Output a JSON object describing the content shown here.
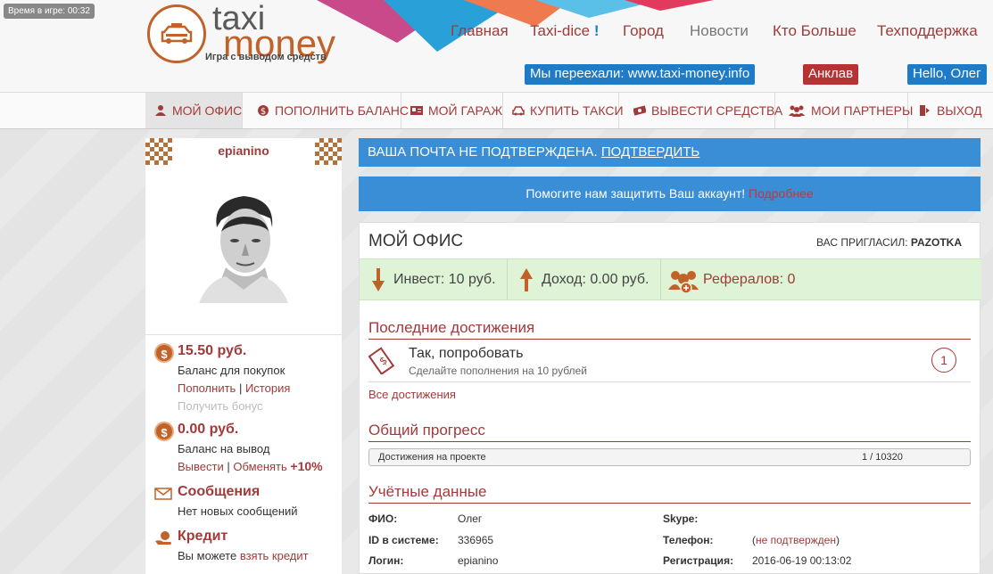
{
  "timer": "Время в игре: 00:32",
  "logo": {
    "top": "taxi",
    "bottom": "money",
    "subtitle": "Игра с выводом средств"
  },
  "topnav": {
    "items": [
      "Главная",
      "Taxi-dice",
      "Город",
      "Новости",
      "Кто Больше",
      "Техподдержка"
    ],
    "dice_mark": "!"
  },
  "notices": {
    "moved": "Мы переехали: www.taxi-money.info",
    "enclave": "Анклав",
    "hello": "Hello, Олег"
  },
  "menu": [
    {
      "label": "Мой офис",
      "icon": "user-icon"
    },
    {
      "label": "Пополнить баланс",
      "icon": "coin-icon"
    },
    {
      "label": "Мой гараж",
      "icon": "id-card-icon"
    },
    {
      "label": "Купить такси",
      "icon": "car-icon"
    },
    {
      "label": "Вывести средства",
      "icon": "money-icon"
    },
    {
      "label": "Мои партнеры",
      "icon": "partners-icon"
    },
    {
      "label": "Выход",
      "icon": "exit-icon"
    }
  ],
  "sidebar": {
    "username": "epianino",
    "balance_buy": {
      "amount": "15.50 руб.",
      "label": "Баланс для покупок",
      "topup": "Пополнить",
      "sep": "|",
      "history": "История",
      "bonus": "Получить бонус"
    },
    "balance_out": {
      "amount": "0.00 руб.",
      "label": "Баланс на вывод",
      "withdraw": "Вывести",
      "sep": "|",
      "exchange": "Обменять",
      "bonus": "+10%"
    },
    "messages": {
      "title": "Сообщения",
      "text": "Нет новых сообщений"
    },
    "credit": {
      "title": "Кредит",
      "text": "Вы можете",
      "link": "взять кредит"
    },
    "coin_glyph": "$"
  },
  "alerts": {
    "email_text": "Ваша почта не подтверждена.",
    "email_link": "Подтвердить",
    "protect_text": "Помогите нам защитить Ваш аккаунт!",
    "protect_link": "Подробнее"
  },
  "office": {
    "title": "Мой офис",
    "invited_label": "Вас пригласил:",
    "invited_by": "PAZOTKA",
    "stats": {
      "invest": "Инвест: 10 руб.",
      "income": "Доход: 0.00 руб.",
      "referrals_label": "Рефералов:",
      "referrals_value": "0"
    },
    "achievements": {
      "title": "Последние достижения",
      "item_title": "Так, попробовать",
      "item_sub": "Сделайте пополнения на 10 рублей",
      "item_count": "1",
      "all_link": "Все достижения"
    },
    "progress": {
      "title": "Общий прогресс",
      "label": "Достижения на проекте",
      "value": "1 / 10320"
    },
    "account": {
      "title": "Учётные данные",
      "fio_label": "ФИО:",
      "fio": "Олег",
      "id_label": "ID в системе:",
      "id": "336965",
      "login_label": "Логин:",
      "login": "epianino",
      "skype_label": "Skype:",
      "skype": "",
      "phone_label": "Телефон:",
      "phone_open": "(",
      "phone": "не подтвержден",
      "phone_close": ")",
      "reg_label": "Регистрация:",
      "reg": "2016-06-19 00:13:02"
    }
  },
  "colors": {
    "accent": "#a23a3a",
    "blue": "#3a8ed6",
    "green": "#dff4d6",
    "orange": "#c0622a"
  }
}
